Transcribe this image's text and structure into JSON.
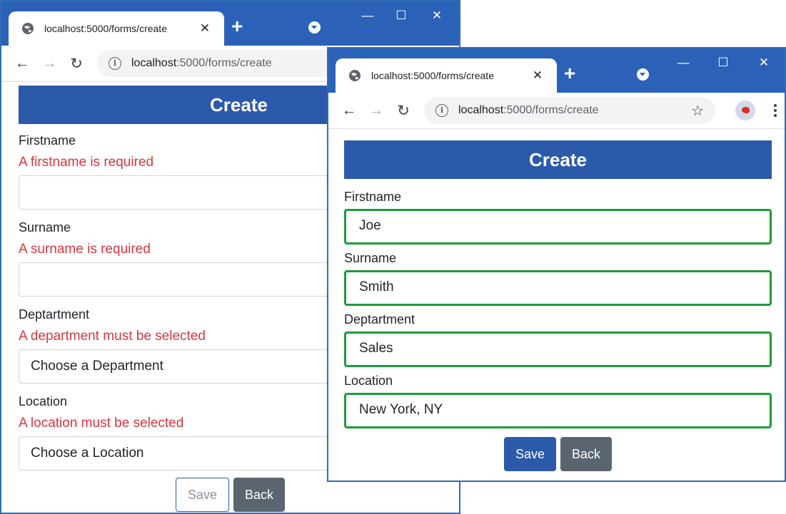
{
  "theme": {
    "chrome_blue": "#2b62b8",
    "header_blue": "#2b5aaa",
    "error_red": "#d9363e",
    "valid_green": "#1e9a3c",
    "back_gray": "#5a6570"
  },
  "back_window": {
    "tab_title": "localhost:5000/forms/create",
    "url_host": "localhost",
    "url_path": ":5000/forms/create",
    "header": "Create",
    "form": {
      "firstname_label": "Firstname",
      "firstname_error": "A firstname is required",
      "firstname_value": "",
      "surname_label": "Surname",
      "surname_error": "A surname is required",
      "surname_value": "",
      "department_label": "Deptartment",
      "department_error": "A department must be selected",
      "department_value": "Choose a Department",
      "location_label": "Location",
      "location_error": "A location must be selected",
      "location_value": "Choose a Location"
    },
    "save_label": "Save",
    "back_label": "Back"
  },
  "front_window": {
    "tab_title": "localhost:5000/forms/create",
    "url_host": "localhost",
    "url_path": ":5000/forms/create",
    "header": "Create",
    "form": {
      "firstname_label": "Firstname",
      "firstname_value": "Joe",
      "surname_label": "Surname",
      "surname_value": "Smith",
      "department_label": "Deptartment",
      "department_value": "Sales",
      "location_label": "Location",
      "location_value": "New York, NY"
    },
    "save_label": "Save",
    "back_label": "Back"
  },
  "icons": {
    "tab_favicon": "globe-icon",
    "tab_close": "close-icon",
    "new_tab": "plus-icon",
    "profile": "chevron-down-icon",
    "minimize": "minimize-icon",
    "maximize": "maximize-icon",
    "window_close": "close-icon",
    "back": "arrow-left-icon",
    "forward": "arrow-right-icon",
    "reload": "reload-icon",
    "site_info": "info-icon",
    "bookmark": "star-icon",
    "account": "avatar-icon",
    "menu": "more-vert-icon"
  }
}
